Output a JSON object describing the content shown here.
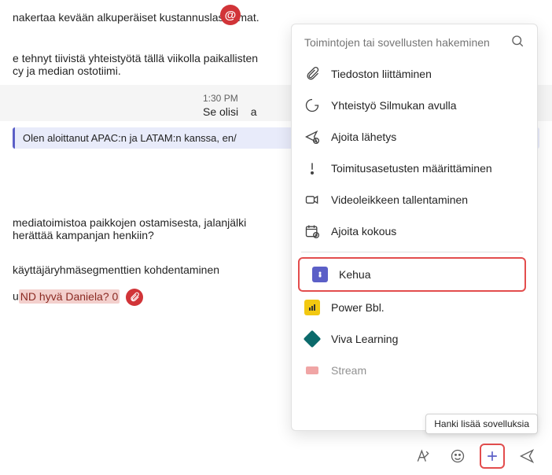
{
  "chat": {
    "at_badge_glyph": "@",
    "line1": "nakertaa kevään alkuperäiset kustannuslaskelmat.",
    "line2a": "tehnyt tiivistä yhteistyötä tällä viikolla paikallisten",
    "line2b": "cy ja median ostotiimi.",
    "ts": "1:30 PM",
    "reply_stub": "Se olisi",
    "quoted": "Olen aloittanut APAC:n ja LATAM:n kanssa, en/",
    "line3a": "mediatoimistoa paikkojen ostamisesta, jalanjälki",
    "line3b": "herättää kampanjan henkiin?",
    "line4": "käyttäjäryhmäsegmenttien kohdentaminen",
    "line5_prefix": "u",
    "line5_hl": "ND hyvä Daniela? 0"
  },
  "popup": {
    "search_placeholder": "Toimintojen tai sovellusten hakeminen",
    "actions": [
      {
        "key": "attach",
        "label": "Tiedoston liittäminen"
      },
      {
        "key": "loop",
        "label": "Yhteistyö Silmukan avulla"
      },
      {
        "key": "schedule",
        "label": "Ajoita lähetys"
      },
      {
        "key": "delivery",
        "label": "Toimitusasetusten määrittäminen"
      },
      {
        "key": "videoclip",
        "label": "Videoleikkeen tallentaminen"
      },
      {
        "key": "meeting",
        "label": "Ajoita kokous"
      }
    ],
    "apps": [
      {
        "key": "kehua",
        "label": "Kehua"
      },
      {
        "key": "powerbbl",
        "label": "Power Bbl."
      },
      {
        "key": "viva",
        "label": "Viva Learning"
      },
      {
        "key": "stream",
        "label": "Stream"
      }
    ],
    "tooltip": "Hanki lisää sovelluksia"
  },
  "icons": {
    "paperclip": "paperclip-icon",
    "loop": "loop-icon",
    "send-later": "send-later-icon",
    "exclaim": "exclaim-icon",
    "video": "video-icon",
    "calendar-add": "calendar-add-icon",
    "format": "format-icon",
    "emoji": "emoji-icon",
    "plus": "plus-icon",
    "send": "send-icon",
    "search": "search-icon"
  }
}
